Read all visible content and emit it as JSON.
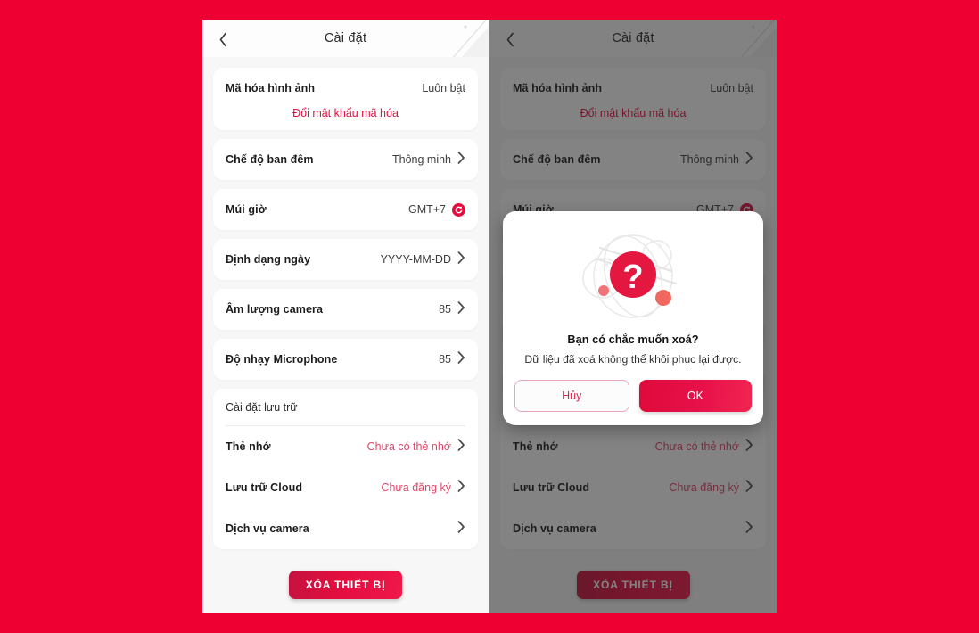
{
  "background_color": "#ee0033",
  "panel": {
    "header": {
      "title": "Cài đặt",
      "back_icon": "chevron-left-icon"
    },
    "encryption": {
      "label": "Mã hóa hình ảnh",
      "value": "Luôn bật",
      "link": "Đổi mật khẩu mã hóa"
    },
    "rows": [
      {
        "label": "Chế độ ban đêm",
        "value": "Thông minh",
        "accessory": "chevron-right-icon",
        "value_style": "muted"
      },
      {
        "label": "Múi giờ",
        "value": "GMT+7",
        "accessory": "refresh-icon",
        "value_style": "muted"
      },
      {
        "label": "Định dạng ngày",
        "value": "YYYY-MM-DD",
        "accessory": "chevron-right-icon",
        "value_style": "muted"
      },
      {
        "label": "Âm lượng camera",
        "value": "85",
        "accessory": "chevron-right-icon",
        "value_style": "muted"
      },
      {
        "label": "Độ nhạy Microphone",
        "value": "85",
        "accessory": "chevron-right-icon",
        "value_style": "muted"
      }
    ],
    "storage": {
      "section_title": "Cài đặt lưu trữ",
      "rows": [
        {
          "label": "Thẻ nhớ",
          "value": "Chưa có thẻ nhớ",
          "accessory": "chevron-right-icon",
          "value_style": "pink"
        },
        {
          "label": "Lưu trữ Cloud",
          "value": "Chưa đăng ký",
          "accessory": "chevron-right-icon",
          "value_style": "pink"
        },
        {
          "label": "Dịch vụ camera",
          "value": "",
          "accessory": "chevron-right-icon",
          "value_style": "muted"
        }
      ]
    },
    "delete_button": "XÓA THIẾT BỊ"
  },
  "modal": {
    "illustration": "question-mark-icon",
    "title": "Bạn có chắc muốn xoá?",
    "subtitle": "Dữ liệu đã xoá không thể khôi phục lại được.",
    "cancel_label": "Hủy",
    "ok_label": "OK",
    "accent_color": "#e30e3f"
  }
}
